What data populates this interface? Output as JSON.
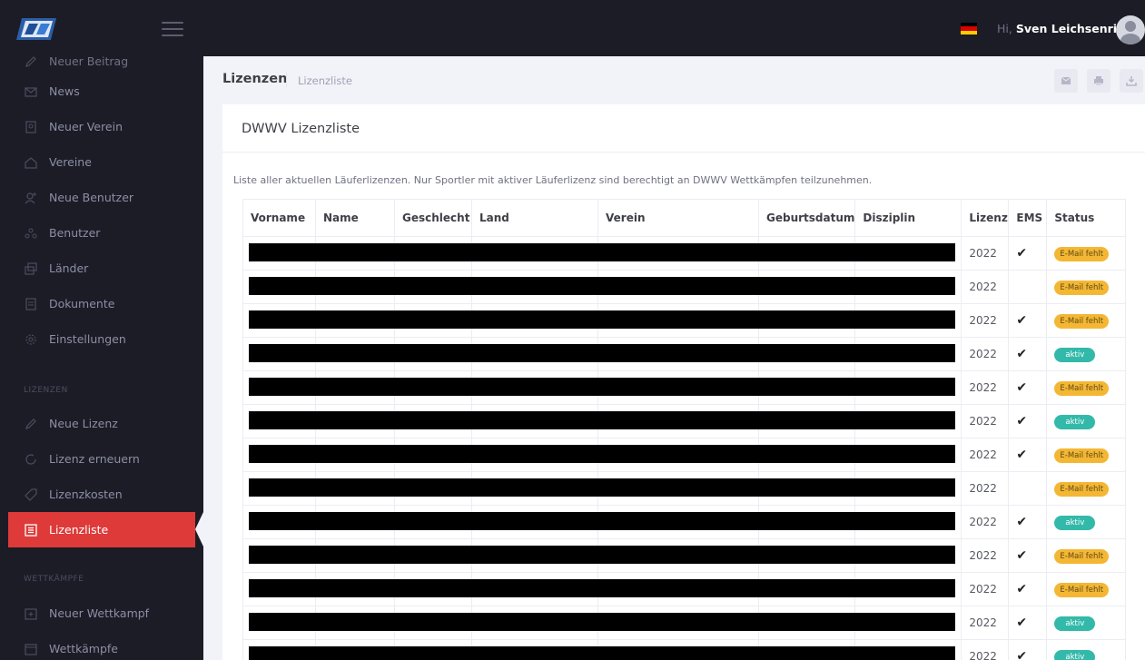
{
  "header": {
    "greeting": "Hi,",
    "user_name": "Sven Leichsenring",
    "language_flag": "de-flag-icon"
  },
  "sidebar": {
    "items_top": [
      {
        "label": "Neuer Beitrag",
        "icon": "pencil-icon"
      },
      {
        "label": "News",
        "icon": "envelope-icon"
      },
      {
        "label": "Neuer Verein",
        "icon": "id-card-icon"
      },
      {
        "label": "Vereine",
        "icon": "home-icon"
      },
      {
        "label": "Neue Benutzer",
        "icon": "user-add-icon"
      },
      {
        "label": "Benutzer",
        "icon": "users-icon"
      },
      {
        "label": "Länder",
        "icon": "windows-icon"
      },
      {
        "label": "Dokumente",
        "icon": "documents-icon"
      },
      {
        "label": "Einstellungen",
        "icon": "gear-icon"
      }
    ],
    "section_lizenzen": "LIZENZEN",
    "items_lizenzen": [
      {
        "label": "Neue Lizenz",
        "icon": "edit-icon"
      },
      {
        "label": "Lizenz erneuern",
        "icon": "refresh-icon"
      },
      {
        "label": "Lizenzkosten",
        "icon": "tag-icon"
      },
      {
        "label": "Lizenzliste",
        "icon": "list-icon",
        "active": true
      }
    ],
    "section_wettkaempfe": "WETTKÄMPFE",
    "items_wettkaempfe": [
      {
        "label": "Neuer Wettkampf",
        "icon": "calendar-add-icon"
      },
      {
        "label": "Wettkämpfe",
        "icon": "calendar-icon"
      }
    ]
  },
  "subheader": {
    "title": "Lizenzen",
    "breadcrumb": "Lizenzliste"
  },
  "portlet": {
    "title": "DWWV Lizenzliste",
    "description": "Liste aller aktuellen Läuferlizenzen. Nur Sportler mit aktiver Läuferlizenz sind berechtigt an DWWV Wettkämpfen teilzunehmen."
  },
  "table": {
    "columns": [
      "Vorname",
      "Name",
      "Geschlecht",
      "Land",
      "Verein",
      "Geburtsdatum",
      "Disziplin",
      "Lizenz",
      "EMS",
      "Status"
    ],
    "rows": [
      {
        "lizenz": "2022",
        "ems": "✔",
        "status": "E-Mail fehlt",
        "status_type": "warn"
      },
      {
        "lizenz": "2022",
        "ems": "",
        "status": "E-Mail fehlt",
        "status_type": "warn"
      },
      {
        "lizenz": "2022",
        "ems": "✔",
        "status": "E-Mail fehlt",
        "status_type": "warn"
      },
      {
        "lizenz": "2022",
        "ems": "✔",
        "status": "aktiv",
        "status_type": "ok"
      },
      {
        "lizenz": "2022",
        "ems": "✔",
        "status": "E-Mail fehlt",
        "status_type": "warn"
      },
      {
        "lizenz": "2022",
        "ems": "✔",
        "status": "aktiv",
        "status_type": "ok"
      },
      {
        "lizenz": "2022",
        "ems": "✔",
        "status": "E-Mail fehlt",
        "status_type": "warn"
      },
      {
        "lizenz": "2022",
        "ems": "",
        "status": "E-Mail fehlt",
        "status_type": "warn"
      },
      {
        "lizenz": "2022",
        "ems": "✔",
        "status": "aktiv",
        "status_type": "ok"
      },
      {
        "lizenz": "2022",
        "ems": "✔",
        "status": "E-Mail fehlt",
        "status_type": "warn"
      },
      {
        "lizenz": "2022",
        "ems": "✔",
        "status": "E-Mail fehlt",
        "status_type": "warn"
      },
      {
        "lizenz": "2022",
        "ems": "✔",
        "status": "aktiv",
        "status_type": "ok"
      },
      {
        "lizenz": "2022",
        "ems": "✔",
        "status": "aktiv",
        "status_type": "ok"
      }
    ]
  },
  "colors": {
    "sidebar_bg": "#1c1c26",
    "active_item": "#de3a3a",
    "badge_warn": "#f4b734",
    "badge_ok": "#33b9a9"
  }
}
